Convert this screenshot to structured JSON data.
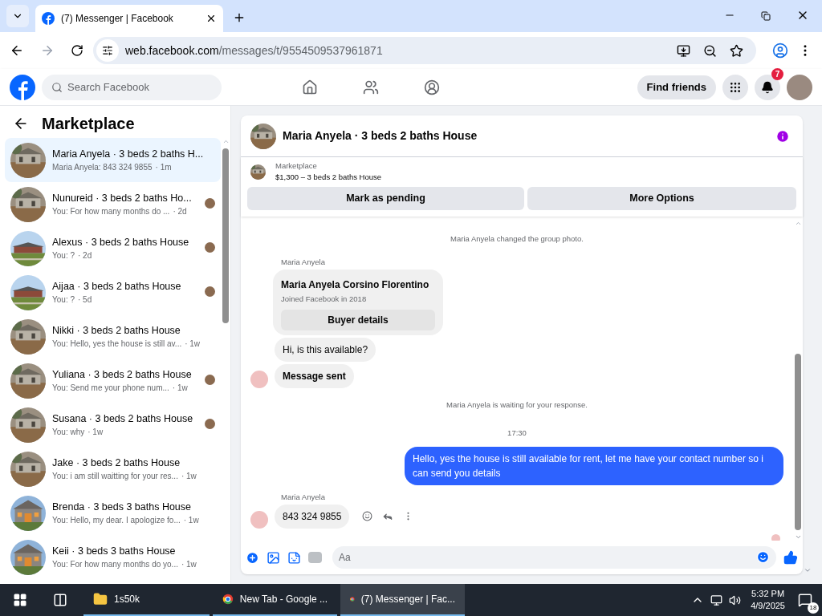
{
  "browser": {
    "tab_title": "(7) Messenger | Facebook",
    "url_host": "web.facebook.com",
    "url_path": "/messages/t/9554509537961871"
  },
  "header": {
    "search_placeholder": "Search Facebook",
    "find_friends": "Find friends",
    "notification_count": "7",
    "nav": [
      {
        "kind": "home",
        "selected": false
      },
      {
        "kind": "friends",
        "selected": false
      },
      {
        "kind": "groups",
        "selected": false
      }
    ]
  },
  "sidebar": {
    "title": "Marketplace",
    "conversations": [
      {
        "title": "Maria Anyela · 3 beds 2 baths H...",
        "preview": "Maria Anyela: 843 324 9855",
        "time": "· 1m",
        "selected": true,
        "seen_avatar": false
      },
      {
        "title": "Nunureid · 3 beds 2 baths Ho...",
        "preview": "You: For how many months do ...",
        "time": "· 2d",
        "selected": false,
        "seen_avatar": true
      },
      {
        "title": "Alexus · 3 beds 2 baths House",
        "preview": "You: ?",
        "time": "· 2d",
        "selected": false,
        "seen_avatar": true
      },
      {
        "title": "Aijaa · 3 beds 2 baths House",
        "preview": "You: ?",
        "time": "· 5d",
        "selected": false,
        "seen_avatar": true
      },
      {
        "title": "Nikki · 3 beds 2 baths House",
        "preview": "You: Hello, yes the house is still av...",
        "time": "· 1w",
        "selected": false,
        "seen_avatar": false
      },
      {
        "title": "Yuliana · 3 beds 2 baths House",
        "preview": "You: Send me your phone num...",
        "time": "· 1w",
        "selected": false,
        "seen_avatar": true
      },
      {
        "title": "Susana · 3 beds 2 baths House",
        "preview": "You: why",
        "time": "· 1w",
        "selected": false,
        "seen_avatar": true
      },
      {
        "title": "Jake · 3 beds 2 baths House",
        "preview": "You: i am still waitting for your res...",
        "time": "· 1w",
        "selected": false,
        "seen_avatar": false
      },
      {
        "title": "Brenda · 3 beds 3 baths House",
        "preview": "You: Hello, my dear. I apologize fo...",
        "time": "· 1w",
        "selected": false,
        "seen_avatar": false
      },
      {
        "title": "Keii · 3 beds 3 baths House",
        "preview": "You: For how many months do yo...",
        "time": "· 1w",
        "selected": false,
        "seen_avatar": false
      }
    ]
  },
  "chat": {
    "title": "Maria Anyela · 3 beds 2 baths House",
    "listing": {
      "label": "Marketplace",
      "price_title": "$1,300 – 3 beds 2 baths House"
    },
    "actions": [
      "Mark as pending",
      "More Options"
    ],
    "messages": [
      {
        "kind": "system",
        "text": "Maria Anyela changed the group photo."
      },
      {
        "kind": "sender",
        "text": "Maria Anyela"
      },
      {
        "kind": "card",
        "name": "Maria Anyela Corsino Florentino",
        "subtitle": "Joined Facebook in 2018",
        "button": "Buyer details"
      },
      {
        "kind": "incoming",
        "text": "Hi, is this available?",
        "avatar": false,
        "bold": false
      },
      {
        "kind": "incoming",
        "text": "Message sent",
        "avatar": true,
        "bold": true
      },
      {
        "kind": "system",
        "text": "Maria Anyela is waiting for your response."
      },
      {
        "kind": "time",
        "text": "17:30"
      },
      {
        "kind": "outgoing",
        "text": "Hello, yes the house is still available for rent, let me have your contact number so i can send you  details"
      },
      {
        "kind": "sender",
        "text": "Maria Anyela"
      },
      {
        "kind": "incoming",
        "text": "843 324 9855",
        "avatar": true,
        "bold": false,
        "hover_actions": true
      }
    ],
    "composer_placeholder": "Aa"
  },
  "taskbar": {
    "apps": [
      {
        "kind": "folder",
        "label": "1s50k",
        "selected": false
      },
      {
        "kind": "chrome",
        "label": "New Tab - Google ...",
        "selected": false
      },
      {
        "kind": "chrome",
        "label": "(7) Messenger | Fac...",
        "selected": true
      }
    ],
    "time": "5:32 PM",
    "date": "4/9/2025",
    "notifications": "18"
  }
}
